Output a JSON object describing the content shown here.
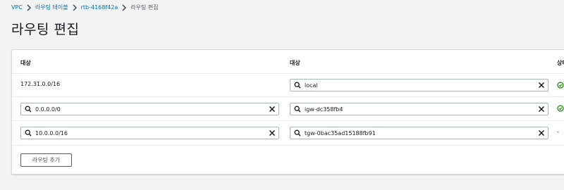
{
  "breadcrumb": {
    "items": [
      {
        "label": "VPC"
      },
      {
        "label": "라우팅 테이블"
      },
      {
        "label": "rtb-4168f42a"
      }
    ],
    "current": "라우팅 편집"
  },
  "page_title": "라우팅 편집",
  "table": {
    "headers": {
      "destination": "대상",
      "target": "대상",
      "status": "상태"
    },
    "rows": [
      {
        "destination": "172.31.0.0/16",
        "destination_editable": false,
        "target": "local",
        "status": "active"
      },
      {
        "destination": "0.0.0.0/0",
        "destination_editable": true,
        "target": "igw-dc358fb4",
        "status": "active"
      },
      {
        "destination": "10.0.0.0/16",
        "destination_editable": true,
        "target": "tgw-0bac35ad15188fb91",
        "status": "-"
      }
    ]
  },
  "add_route_label": "라우팅 추가",
  "icons": {
    "breadcrumb_separator": "chevron-right-icon",
    "search": "search-icon",
    "clear": "close-icon",
    "status_ok": "check-circle-icon"
  },
  "colors": {
    "link": "#0073bb",
    "success": "#1d8102",
    "page_background": "#f2f3f3"
  }
}
